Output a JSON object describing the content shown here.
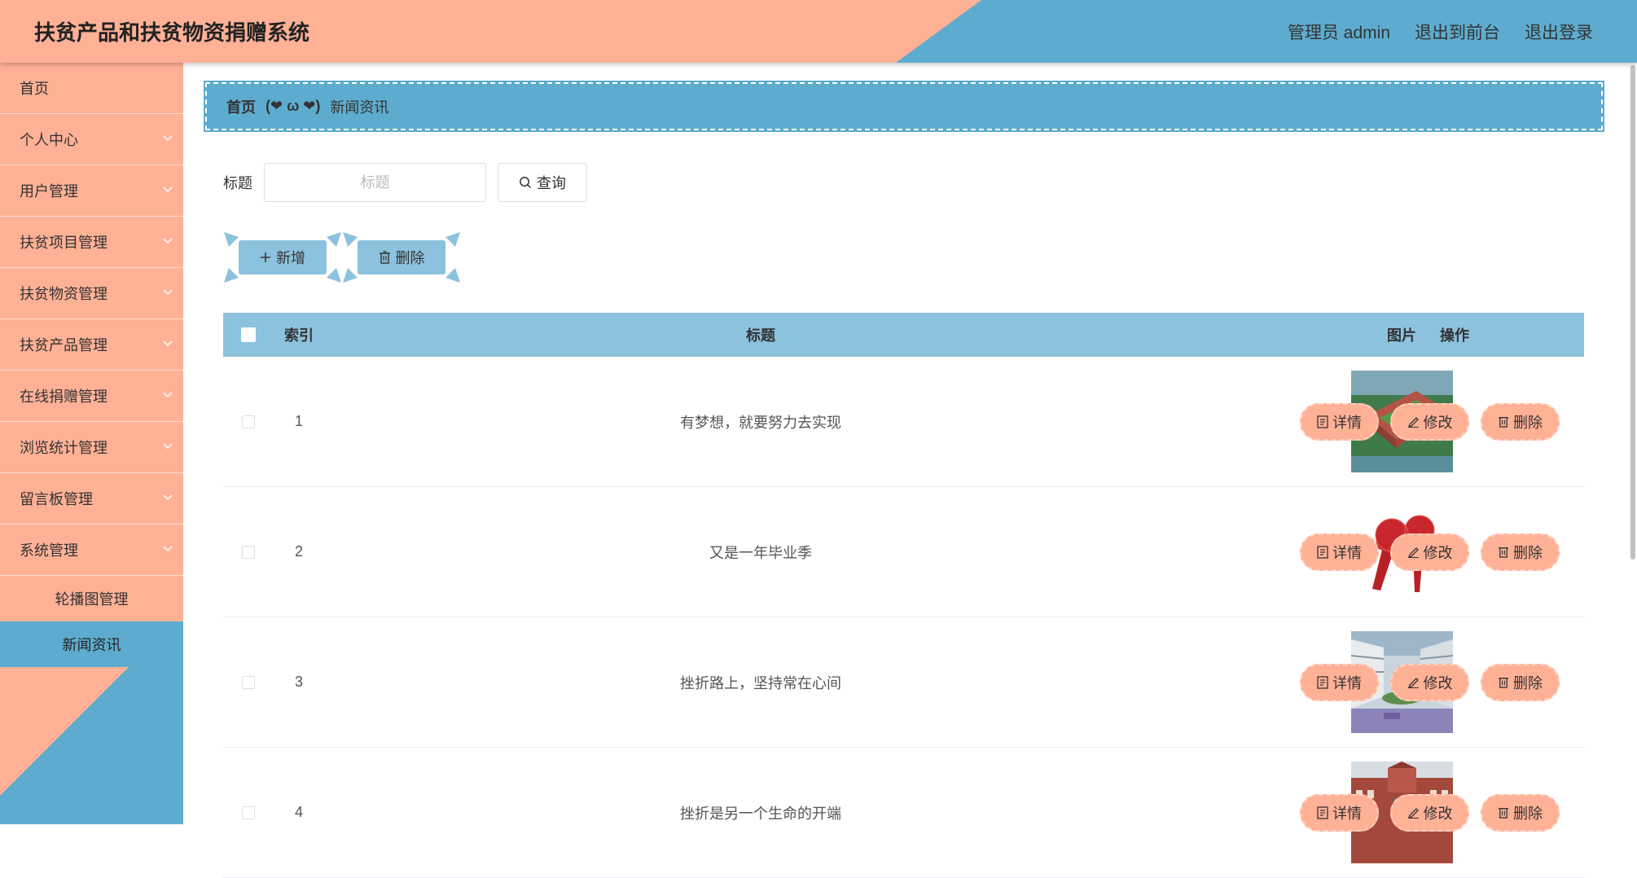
{
  "header": {
    "title": "扶贫产品和扶贫物资捐赠系统",
    "nav": [
      "管理员 admin",
      "退出到前台",
      "退出登录"
    ]
  },
  "sidebar": {
    "items": [
      {
        "label": "首页",
        "has_children": false
      },
      {
        "label": "个人中心",
        "has_children": true
      },
      {
        "label": "用户管理",
        "has_children": true
      },
      {
        "label": "扶贫项目管理",
        "has_children": true
      },
      {
        "label": "扶贫物资管理",
        "has_children": true
      },
      {
        "label": "扶贫产品管理",
        "has_children": true
      },
      {
        "label": "在线捐赠管理",
        "has_children": true
      },
      {
        "label": "浏览统计管理",
        "has_children": true
      },
      {
        "label": "留言板管理",
        "has_children": true
      },
      {
        "label": "系统管理",
        "has_children": true
      }
    ],
    "submenu": [
      {
        "label": "轮播图管理",
        "active": false
      },
      {
        "label": "新闻资讯",
        "active": true
      }
    ]
  },
  "breadcrumb": {
    "home": "首页",
    "separator": "(❤ ω ❤)",
    "current": "新闻资讯"
  },
  "search": {
    "label": "标题",
    "placeholder": "标题",
    "value": "",
    "button": "查询"
  },
  "actions": {
    "add": "新增",
    "delete": "删除"
  },
  "table": {
    "headers": {
      "index": "索引",
      "title": "标题",
      "image": "图片",
      "ops": "操作"
    },
    "rows": [
      {
        "index": "1",
        "title": "有梦想，就要努力去实现",
        "image": "campus-aerial"
      },
      {
        "index": "2",
        "title": "又是一年毕业季",
        "image": "news-live-microphones"
      },
      {
        "index": "3",
        "title": "挫折路上，坚持常在心间",
        "image": "school-courtyard"
      },
      {
        "index": "4",
        "title": "挫折是另一个生命的开端",
        "image": "school-building"
      }
    ],
    "row_actions": {
      "detail": "详情",
      "edit": "修改",
      "delete": "删除"
    }
  },
  "colors": {
    "accent_blue": "#5daccf",
    "light_blue": "#8cc2dd",
    "salmon": "#ffb196"
  }
}
